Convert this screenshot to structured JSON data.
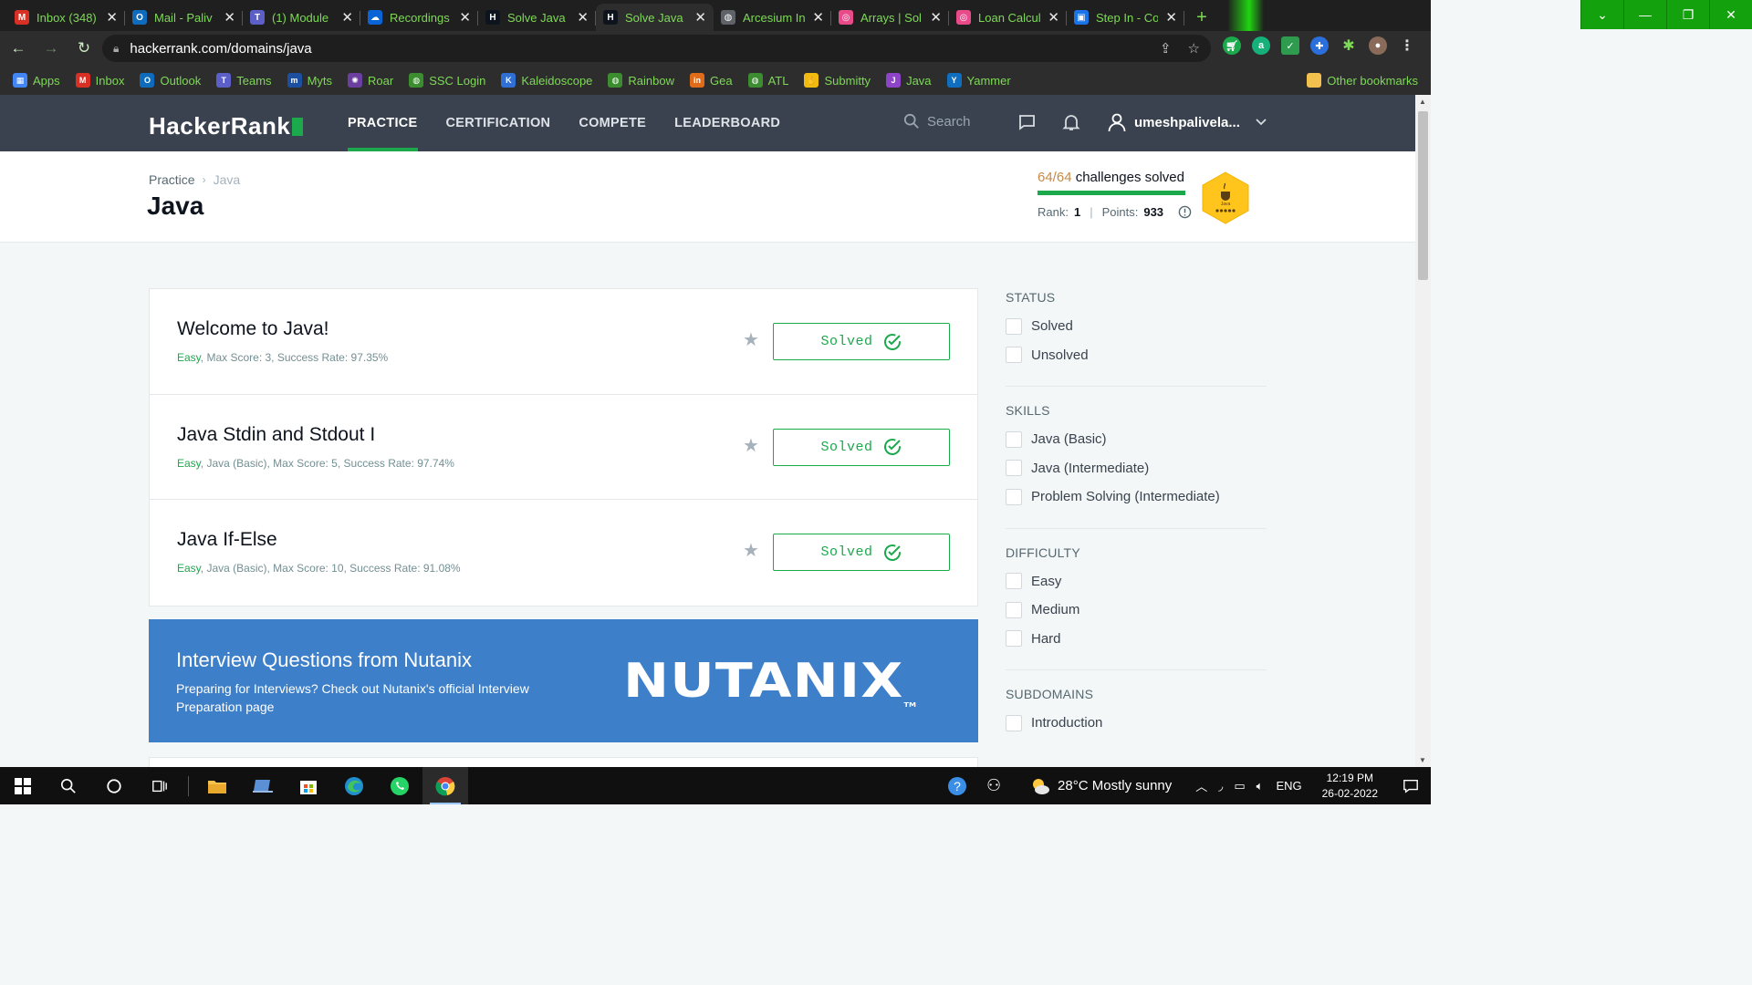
{
  "browser": {
    "tabs": [
      {
        "title": "Inbox (348)",
        "icon": "gmail-icon",
        "color": "#d93025",
        "glyph": "M"
      },
      {
        "title": "Mail - Paliv",
        "icon": "outlook-icon",
        "color": "#0f6cbd",
        "glyph": "O"
      },
      {
        "title": "(1) Module",
        "icon": "teams-icon",
        "color": "#5b5fc7",
        "glyph": "T"
      },
      {
        "title": "Recordings",
        "icon": "onedrive-icon",
        "color": "#0a64d6",
        "glyph": "☁"
      },
      {
        "title": "Solve Java |",
        "icon": "hackerrank-icon",
        "color": "#0e141e",
        "glyph": "H"
      },
      {
        "title": "Solve Java |",
        "icon": "hackerrank-icon",
        "color": "#0e141e",
        "glyph": "H"
      },
      {
        "title": "Arcesium In",
        "icon": "globe-icon",
        "color": "#5f6368",
        "glyph": "◍"
      },
      {
        "title": "Arrays | Sol",
        "icon": "swirl-icon",
        "color": "#e94b8a",
        "glyph": "◎"
      },
      {
        "title": "Loan Calcul",
        "icon": "swirl-icon",
        "color": "#e94b8a",
        "glyph": "◎"
      },
      {
        "title": "Step In - Co",
        "icon": "stepin-icon",
        "color": "#1a73e8",
        "glyph": "▣"
      }
    ],
    "active_tab_index": 5,
    "new_tab_label": "+",
    "url": "hackerrank.com/domains/java",
    "bookmarks": [
      {
        "label": "Apps",
        "icon": "apps-grid-icon",
        "color": "#4285f4",
        "glyph": "▦"
      },
      {
        "label": "Inbox",
        "icon": "gmail-icon",
        "color": "#d93025",
        "glyph": "M"
      },
      {
        "label": "Outlook",
        "icon": "outlook-icon",
        "color": "#0f6cbd",
        "glyph": "O"
      },
      {
        "label": "Teams",
        "icon": "teams-icon",
        "color": "#5b5fc7",
        "glyph": "T"
      },
      {
        "label": "Myts",
        "icon": "myts-icon",
        "color": "#1c4fa0",
        "glyph": "m"
      },
      {
        "label": "Roar",
        "icon": "roar-icon",
        "color": "#6a3fa0",
        "glyph": "✺"
      },
      {
        "label": "SSC Login",
        "icon": "globe-icon",
        "color": "#3c8d2f",
        "glyph": "◍"
      },
      {
        "label": "Kaleidoscope",
        "icon": "kaleidoscope-icon",
        "color": "#2f6fd6",
        "glyph": "K"
      },
      {
        "label": "Rainbow",
        "icon": "globe-icon",
        "color": "#3c8d2f",
        "glyph": "◍"
      },
      {
        "label": "Gea",
        "icon": "gea-icon",
        "color": "#e06c1a",
        "glyph": "in"
      },
      {
        "label": "ATL",
        "icon": "globe-icon",
        "color": "#3c8d2f",
        "glyph": "◍"
      },
      {
        "label": "Submitty",
        "icon": "submitty-icon",
        "color": "#f2b90f",
        "glyph": "✋"
      },
      {
        "label": "Java",
        "icon": "java-bookmark-icon",
        "color": "#8e44c8",
        "glyph": "J"
      },
      {
        "label": "Yammer",
        "icon": "yammer-icon",
        "color": "#106ebe",
        "glyph": "Y"
      }
    ],
    "other_bookmarks": "Other bookmarks"
  },
  "hr": {
    "logo": "HackerRank",
    "nav": [
      {
        "label": "PRACTICE",
        "active": true
      },
      {
        "label": "CERTIFICATION",
        "active": false
      },
      {
        "label": "COMPETE",
        "active": false
      },
      {
        "label": "LEADERBOARD",
        "active": false
      }
    ],
    "search_placeholder": "Search",
    "username": "umeshpalivela..."
  },
  "page": {
    "breadcrumb": [
      "Practice",
      "Java"
    ],
    "title": "Java",
    "solved": "64/64",
    "solved_suffix": "challenges solved",
    "progress_fraction": 1.0,
    "rank_label": "Rank:",
    "rank": "1",
    "points_label": "Points:",
    "points": "933",
    "badge_label": "Java"
  },
  "challenges": [
    {
      "name": "Welcome to Java!",
      "difficulty": "Easy",
      "details": ", Max Score: 3, Success Rate: 97.35%",
      "status": "Solved"
    },
    {
      "name": "Java Stdin and Stdout I",
      "difficulty": "Easy",
      "details": ", Java (Basic), Max Score: 5, Success Rate: 97.74%",
      "status": "Solved"
    },
    {
      "name": "Java If-Else",
      "difficulty": "Easy",
      "details": ", Java (Basic), Max Score: 10, Success Rate: 91.08%",
      "status": "Solved"
    }
  ],
  "promo": {
    "title": "Interview Questions from Nutanix",
    "desc": "Preparing for Interviews? Check out Nutanix's official Interview Preparation page",
    "logo": "NUTANIX",
    "tm": "TM"
  },
  "filters": [
    {
      "heading": "STATUS",
      "options": [
        "Solved",
        "Unsolved"
      ]
    },
    {
      "heading": "SKILLS",
      "options": [
        "Java (Basic)",
        "Java (Intermediate)",
        "Problem Solving (Intermediate)"
      ]
    },
    {
      "heading": "DIFFICULTY",
      "options": [
        "Easy",
        "Medium",
        "Hard"
      ]
    },
    {
      "heading": "SUBDOMAINS",
      "options": [
        "Introduction"
      ]
    }
  ],
  "taskbar": {
    "weather": "28°C  Mostly sunny",
    "language": "ENG",
    "time": "12:19 PM",
    "date": "26-02-2022"
  }
}
